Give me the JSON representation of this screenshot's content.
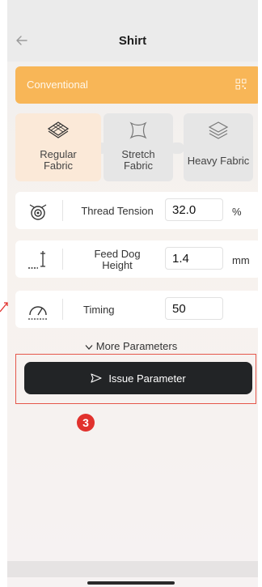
{
  "header": {
    "title": "Shirt"
  },
  "mode": {
    "label": "Conventional"
  },
  "fabrics": [
    {
      "label": "Regular Fabric",
      "line1": "Regular",
      "line2": "Fabric",
      "selected": true
    },
    {
      "label": "Stretch Fabric",
      "line1": "Stretch",
      "line2": "Fabric",
      "selected": false
    },
    {
      "label": "Heavy Fabric",
      "line1": "Heavy Fabric",
      "line2": "",
      "selected": false
    }
  ],
  "params": [
    {
      "label_line1": "Thread Tension",
      "label_line2": "",
      "value": "32.0",
      "unit": "%"
    },
    {
      "label_line1": "Feed Dog",
      "label_line2": "Height",
      "value": "1.4",
      "unit": "mm"
    },
    {
      "label_line1": "Timing",
      "label_line2": "",
      "value": "50",
      "unit": ""
    }
  ],
  "more_parameters": "More Parameters",
  "issue_button": "Issue Parameter",
  "step_badge": "3",
  "colors": {
    "accent": "#f8b657",
    "button": "#222426",
    "highlight": "#e5574b",
    "badge": "#e1322d"
  },
  "icons": [
    "back-arrow-icon",
    "qr-code-icon",
    "regular-fabric-icon",
    "stretch-fabric-icon",
    "heavy-fabric-icon",
    "thread-tension-icon",
    "feed-dog-height-icon",
    "timing-gauge-icon",
    "chevron-down-icon",
    "send-icon"
  ]
}
